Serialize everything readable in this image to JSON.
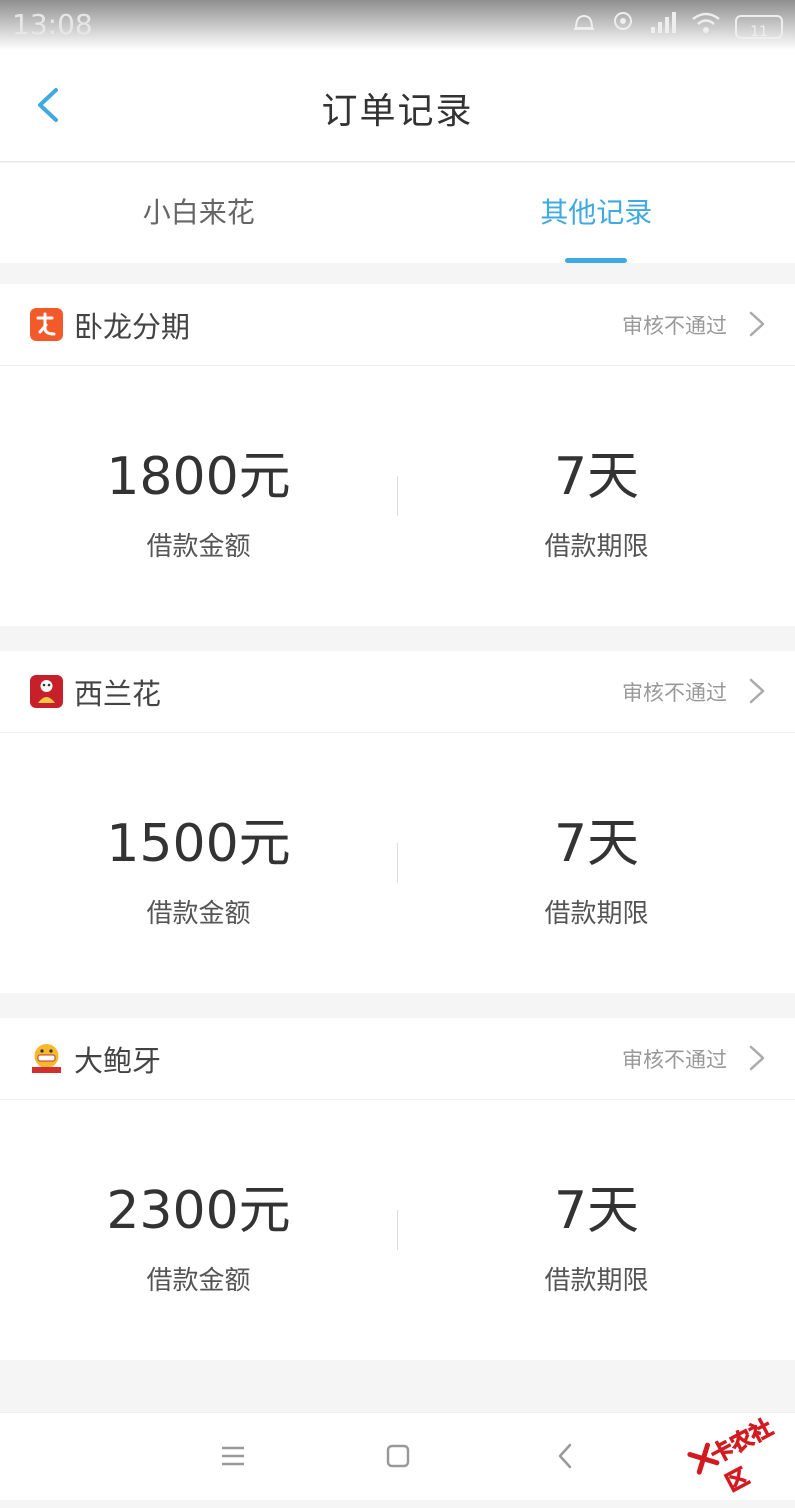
{
  "status_bar": {
    "time": "13:08",
    "battery_level": "11"
  },
  "header": {
    "title": "订单记录"
  },
  "tabs": [
    {
      "label": "小白来花",
      "active": false
    },
    {
      "label": "其他记录",
      "active": true
    }
  ],
  "colors": {
    "accent": "#3fa9e3",
    "status_gray": "#999999"
  },
  "records": [
    {
      "name": "卧龙分期",
      "status": "审核不通过",
      "amount": "1800元",
      "amount_label": "借款金额",
      "term": "7天",
      "term_label": "借款期限",
      "logo": "long-logo-icon"
    },
    {
      "name": "西兰花",
      "status": "审核不通过",
      "amount": "1500元",
      "amount_label": "借款金额",
      "term": "7天",
      "term_label": "借款期限",
      "logo": "xilanhua-logo-icon"
    },
    {
      "name": "大鲍牙",
      "status": "审核不通过",
      "amount": "2300元",
      "amount_label": "借款金额",
      "term": "7天",
      "term_label": "借款期限",
      "logo": "dabaoya-logo-icon"
    }
  ],
  "watermark": {
    "text": "卡农社区"
  }
}
